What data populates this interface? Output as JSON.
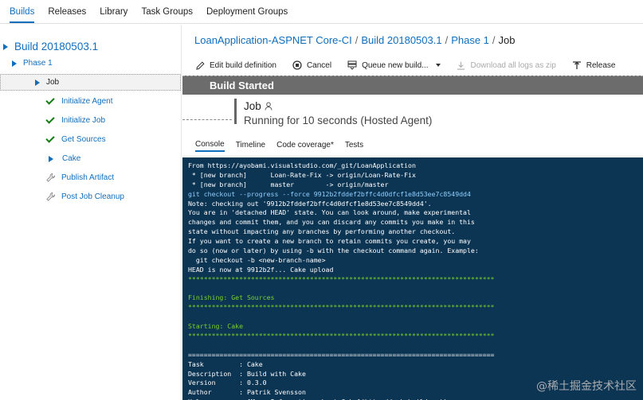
{
  "topnav": {
    "tabs": [
      {
        "label": "Builds",
        "active": true
      },
      {
        "label": "Releases",
        "active": false
      },
      {
        "label": "Library",
        "active": false
      },
      {
        "label": "Task Groups",
        "active": false
      },
      {
        "label": "Deployment Groups",
        "active": false
      }
    ]
  },
  "tree": {
    "build": "Build 20180503.1",
    "phase": "Phase 1",
    "job": "Job",
    "steps": [
      {
        "label": "Initialize Agent",
        "status": "succeeded",
        "icon": "check-icon"
      },
      {
        "label": "Initialize Job",
        "status": "succeeded",
        "icon": "check-icon"
      },
      {
        "label": "Get Sources",
        "status": "succeeded",
        "icon": "check-icon"
      },
      {
        "label": "Cake",
        "status": "running",
        "icon": "expand-triangle-icon"
      },
      {
        "label": "Publish Artifact",
        "status": "pending",
        "icon": "wrench-icon"
      },
      {
        "label": "Post Job Cleanup",
        "status": "pending",
        "icon": "wrench-icon"
      }
    ]
  },
  "breadcrumb": {
    "pipeline": "LoanApplication-ASPNET Core-CI",
    "build": "Build 20180503.1",
    "phase": "Phase 1",
    "current": "Job",
    "separator": "/"
  },
  "toolbar": {
    "edit": "Edit build definition",
    "cancel": "Cancel",
    "queue": "Queue new build...",
    "download": "Download all logs as zip",
    "release": "Release"
  },
  "banner": {
    "text": "Build Started"
  },
  "job": {
    "title": "Job",
    "status": "Running for 10 seconds (Hosted Agent)"
  },
  "subtabs": [
    {
      "label": "Console",
      "active": true
    },
    {
      "label": "Timeline",
      "active": false
    },
    {
      "label": "Code coverage*",
      "active": false
    },
    {
      "label": "Tests",
      "active": false
    }
  ],
  "console": {
    "lines": [
      {
        "text": "From https://ayobami.visualstudio.com/_git/LoanApplication",
        "style": "white"
      },
      {
        "text": " * [new branch]      Loan-Rate-Fix -> origin/Loan-Rate-Fix",
        "style": "white"
      },
      {
        "text": " * [new branch]      master        -> origin/master",
        "style": "white"
      },
      {
        "text": "git checkout --progress --force 9912b2fddef2bffc4d0dfcf1e8d53ee7c8549dd4",
        "style": "cmd"
      },
      {
        "text": "Note: checking out '9912b2fddef2bffc4d0dfcf1e8d53ee7c8549dd4'.",
        "style": "white"
      },
      {
        "text": "You are in 'detached HEAD' state. You can look around, make experimental",
        "style": "white"
      },
      {
        "text": "changes and commit them, and you can discard any commits you make in this",
        "style": "white"
      },
      {
        "text": "state without impacting any branches by performing another checkout.",
        "style": "white"
      },
      {
        "text": "If you want to create a new branch to retain commits you create, you may",
        "style": "white"
      },
      {
        "text": "do so (now or later) by using -b with the checkout command again. Example:",
        "style": "white"
      },
      {
        "text": "  git checkout -b <new-branch-name>",
        "style": "white"
      },
      {
        "text": "HEAD is now at 9912b2f... Cake upload",
        "style": "white"
      },
      {
        "text": "******************************************************************************",
        "style": "sep"
      },
      {
        "text": "",
        "style": "white"
      },
      {
        "text": "Finishing: Get Sources",
        "style": "green"
      },
      {
        "text": "******************************************************************************",
        "style": "sep"
      },
      {
        "text": "",
        "style": "white"
      },
      {
        "text": "Starting: Cake",
        "style": "green"
      },
      {
        "text": "******************************************************************************",
        "style": "sep"
      },
      {
        "text": "",
        "style": "white"
      },
      {
        "text": "==============================================================================",
        "style": "white"
      },
      {
        "text": "Task         : Cake",
        "style": "white"
      },
      {
        "text": "Description  : Build with Cake",
        "style": "white"
      },
      {
        "text": "Version      : 0.3.0",
        "style": "white"
      },
      {
        "text": "Author       : Patrik Svensson",
        "style": "white"
      },
      {
        "text": "Help         : [More Information about Cake](http://cakebuild.net)",
        "style": "white"
      },
      {
        "text": "==============================================================================",
        "style": "white"
      }
    ]
  },
  "watermark": "@稀土掘金技术社区",
  "colors": {
    "accent": "#106ebe",
    "success": "#107c10",
    "console_bg": "#0c3453",
    "console_green": "#7bd12b",
    "banner_bg": "#6c6c6c"
  }
}
